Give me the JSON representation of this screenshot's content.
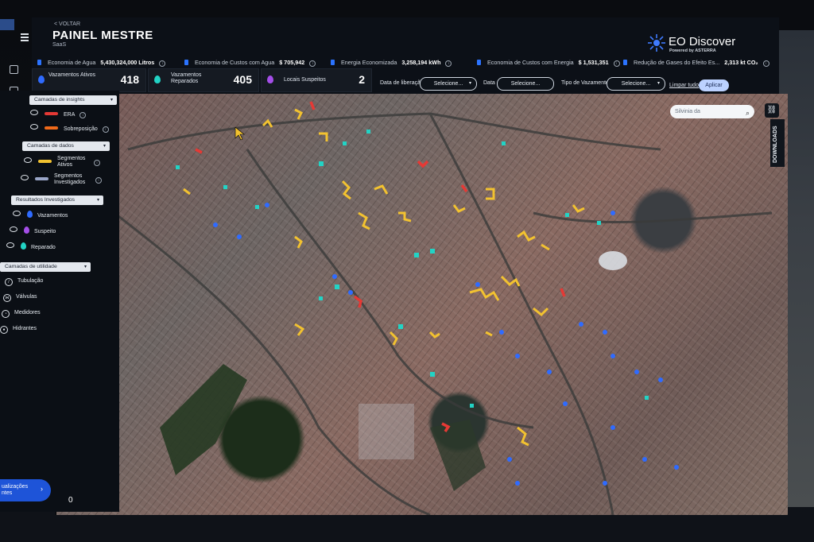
{
  "header": {
    "back_label": "< VOLTAR",
    "title": "PAINEL MESTRE",
    "subtitle": "SaaS"
  },
  "brand": {
    "name": "EO Discover",
    "powered_by": "Powered by ASTERRA"
  },
  "metrics": [
    {
      "label": "Economia de Agua",
      "value": "5,430,324,000 Litros",
      "icon": "water-icon"
    },
    {
      "label": "Economia de Custos com Agua",
      "value": "$ 705,942",
      "icon": "cost-icon"
    },
    {
      "label": "Energia Economizada",
      "value": "3,258,194 kWh",
      "icon": "energy-icon"
    },
    {
      "label": "Economia de Custos com Energia",
      "value": "$ 1,531,351",
      "icon": "energy-cost-icon"
    },
    {
      "label": "Redução de Gases do Efeito Es...",
      "value": "2,313 kt CO₂",
      "icon": "cloud-icon"
    }
  ],
  "stats": [
    {
      "label": "Vazamentos Ativos",
      "value": "418",
      "color": "#2f6bff"
    },
    {
      "label": "Vazamentos Reparados",
      "value": "405",
      "color": "#22d3c5"
    },
    {
      "label": "Locais Suspeitos",
      "value": "2",
      "color": "#a44ee8"
    }
  ],
  "filters": {
    "release_date_label": "Data de liberação",
    "release_date_value": "Selecione...",
    "date_label": "Data",
    "date_value": "Selecione...",
    "leak_type_label": "Tipo de Vazamento",
    "leak_type_value": "Selecione...",
    "clear_label": "Limpar tudo",
    "apply_label": "Aplicar"
  },
  "map": {
    "search_placeholder": "Silvinia da",
    "downloads_label": "DOWNLOADS",
    "scale_glyph": "0"
  },
  "layers": {
    "insights": {
      "title": "Camadas de insights",
      "items": [
        {
          "label": "ERA",
          "color": "#e53935"
        },
        {
          "label": "Sobreposição",
          "color": "#f06a1a"
        }
      ]
    },
    "data": {
      "title": "Camadas de dados",
      "items": [
        {
          "label": "Segmentos Ativos",
          "color": "#f2c230"
        },
        {
          "label": "Segmentos Investigados",
          "color": "#9aa6c8"
        }
      ]
    },
    "results": {
      "title": "Resultados Investigados",
      "items": [
        {
          "label": "Vazamentos",
          "color": "#2f6bff"
        },
        {
          "label": "Suspeito",
          "color": "#a44ee8"
        },
        {
          "label": "Reparado",
          "color": "#22d3c5"
        }
      ]
    },
    "utility": {
      "title": "Camadas de utilidade",
      "items": [
        {
          "label": "Tubulação",
          "icon": "pipe-icon"
        },
        {
          "label": "Válvulas",
          "icon": "valve-icon"
        },
        {
          "label": "Medidores",
          "icon": "meter-icon"
        },
        {
          "label": "Hidrantes",
          "icon": "hydrant-icon"
        }
      ]
    }
  },
  "viz_button": {
    "label": "ualizações\nntes"
  }
}
